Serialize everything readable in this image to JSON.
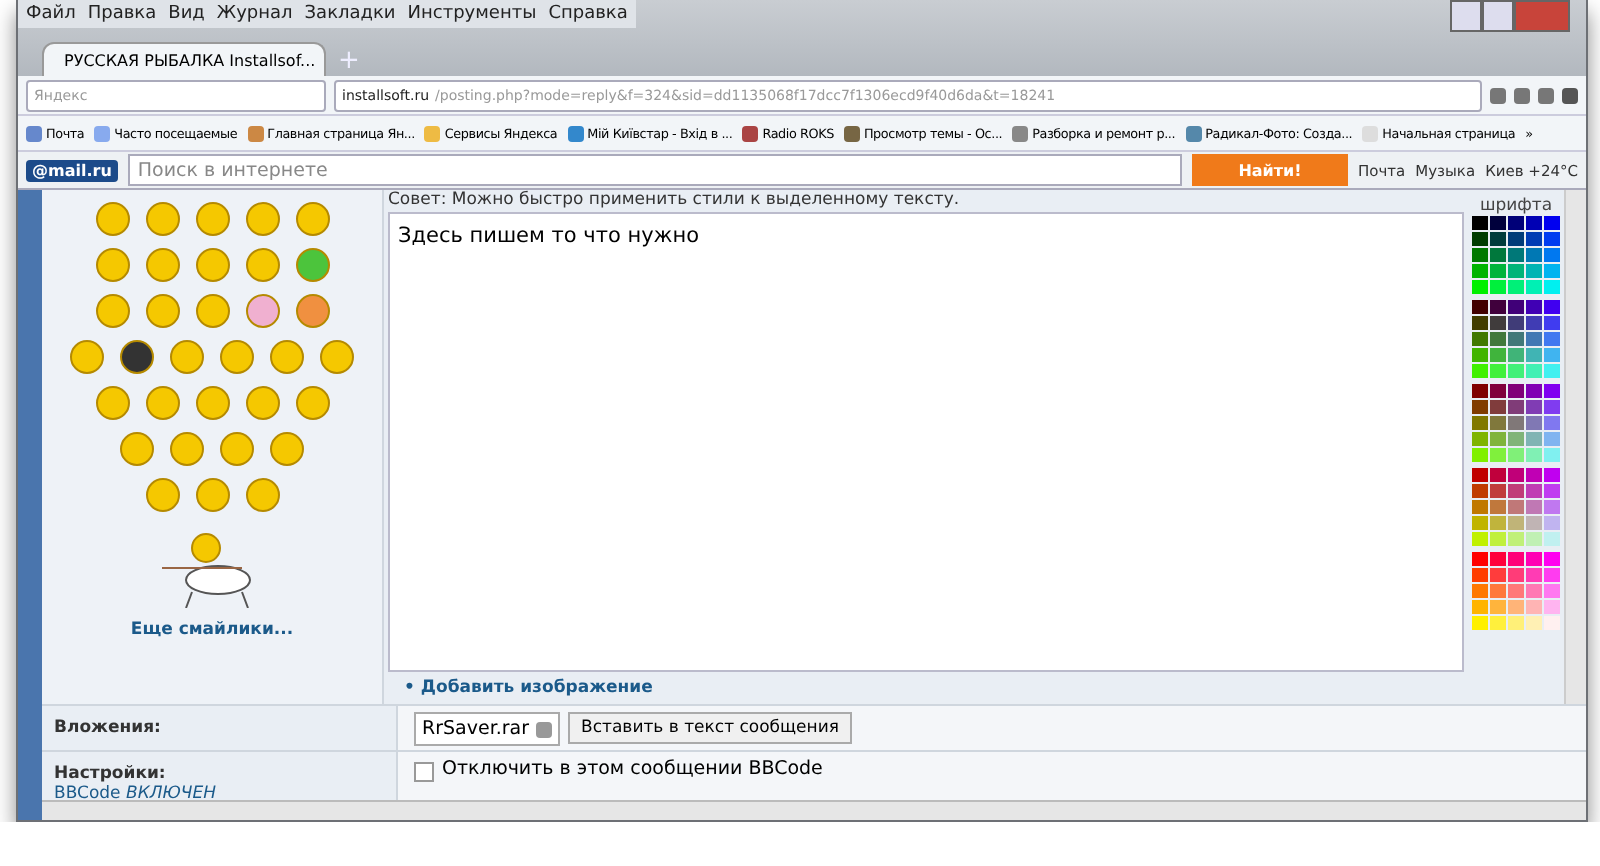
{
  "menu": [
    "Файл",
    "Правка",
    "Вид",
    "Журнал",
    "Закладки",
    "Инструменты",
    "Справка"
  ],
  "tab": {
    "title": "РУССКАЯ РЫБАЛКА Installsof...",
    "selected": true
  },
  "new_tab": "+",
  "search": {
    "placeholder": "Яндекс"
  },
  "address": {
    "host": "installsoft.ru",
    "path": "/posting.php?mode=reply&f=324&sid=dd1135068f17dcc7f1306ecd9f40d6da&t=18241"
  },
  "bookmarks": [
    "Почта",
    "Часто посещаемые",
    "Главная страница Ян...",
    "Сервисы Яндекса",
    "Мій Київстар - Вхід в ...",
    "Radio ROKS",
    "Просмотр темы - Ос...",
    "Разборка и ремонт р...",
    "Радикал-Фото: Созда...",
    "Начальная страница"
  ],
  "mailbar": {
    "logo": "@mail.ru",
    "placeholder": "Поиск в интернете",
    "button": "Найти!",
    "links": [
      "Почта",
      "Музыка",
      "Киев +24°C"
    ]
  },
  "smilies_link": "Еще смайлики...",
  "tip": "Совет: Можно быстро применить стили к выделенному тексту.",
  "editor_text": "Здесь пишем то что нужно",
  "palette_label": "шрифта",
  "bookmarks_more": "»",
  "add_image_bullet": "•",
  "add_image": "Добавить изображение",
  "attachments": {
    "label": "Вложения:",
    "file": "RrSaver.rar",
    "button": "Вставить в текст сообщения"
  },
  "settings": {
    "label": "Настройки:",
    "bbcode": "BBCode",
    "bbcode_state": "ВКЛЮЧЕН",
    "options": [
      {
        "label": "Отключить в этом сообщении BBCode",
        "checked": false
      }
    ]
  }
}
